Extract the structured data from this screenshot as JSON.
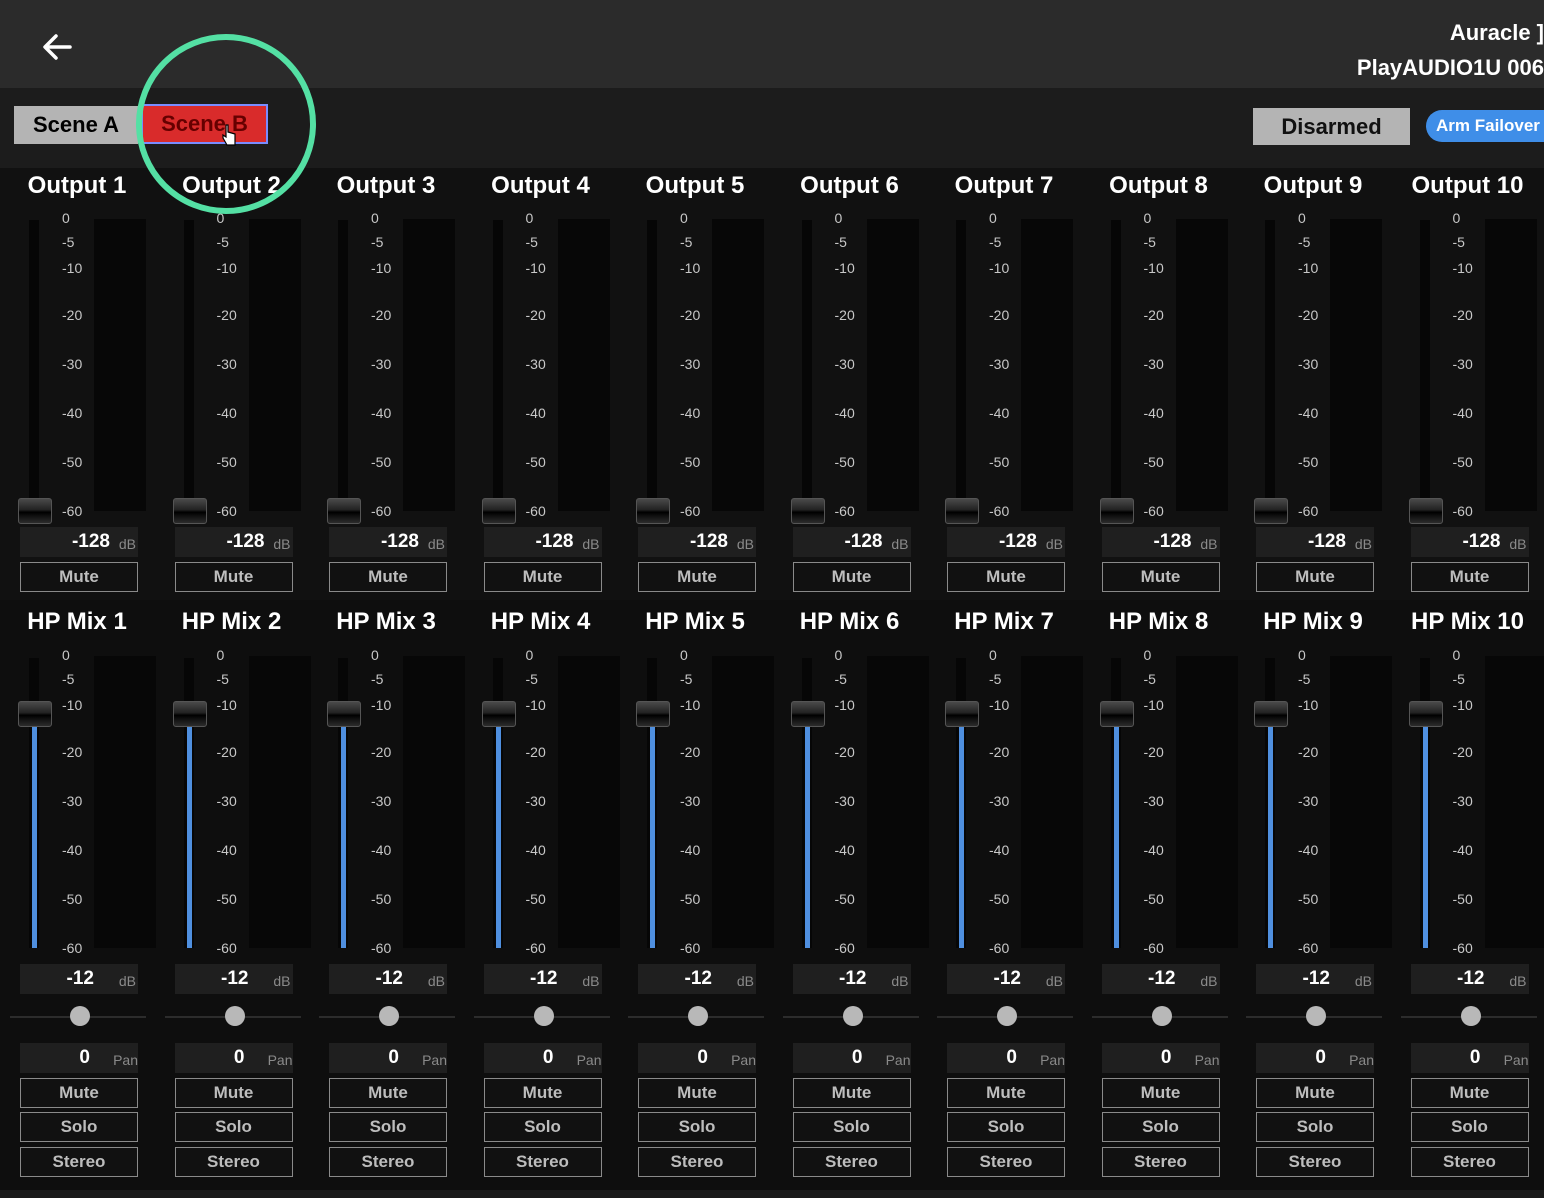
{
  "header": {
    "device_name": "Auracle ]",
    "device_id": "PlayAUDIO1U 006"
  },
  "scenes": {
    "scene_a": "Scene A",
    "scene_b": "Scene B"
  },
  "failover": {
    "status": "Disarmed",
    "arm_label": "Arm Failover"
  },
  "colors": {
    "scene_active": "#d92b2b",
    "highlight_ring": "#54e0a4",
    "fader_fill": "#4f8fdf",
    "arm_button": "#3f8ee8"
  },
  "scale_labels": [
    "0",
    "-5",
    "-10",
    "-20",
    "-30",
    "-40",
    "-50",
    "-60"
  ],
  "outputs": [
    {
      "title": "Output 1",
      "level": "-128",
      "unit": "dB",
      "mute": "Mute"
    },
    {
      "title": "Output 2",
      "level": "-128",
      "unit": "dB",
      "mute": "Mute"
    },
    {
      "title": "Output 3",
      "level": "-128",
      "unit": "dB",
      "mute": "Mute"
    },
    {
      "title": "Output 4",
      "level": "-128",
      "unit": "dB",
      "mute": "Mute"
    },
    {
      "title": "Output 5",
      "level": "-128",
      "unit": "dB",
      "mute": "Mute"
    },
    {
      "title": "Output 6",
      "level": "-128",
      "unit": "dB",
      "mute": "Mute"
    },
    {
      "title": "Output 7",
      "level": "-128",
      "unit": "dB",
      "mute": "Mute"
    },
    {
      "title": "Output 8",
      "level": "-128",
      "unit": "dB",
      "mute": "Mute"
    },
    {
      "title": "Output 9",
      "level": "-128",
      "unit": "dB",
      "mute": "Mute"
    },
    {
      "title": "Output 10",
      "level": "-128",
      "unit": "dB",
      "mute": "Mute"
    }
  ],
  "hp_mixes": [
    {
      "title": "HP Mix 1",
      "level": "-12",
      "unit": "dB",
      "pan": "0",
      "pan_label": "Pan",
      "mute": "Mute",
      "solo": "Solo",
      "stereo": "Stereo"
    },
    {
      "title": "HP Mix 2",
      "level": "-12",
      "unit": "dB",
      "pan": "0",
      "pan_label": "Pan",
      "mute": "Mute",
      "solo": "Solo",
      "stereo": "Stereo"
    },
    {
      "title": "HP Mix 3",
      "level": "-12",
      "unit": "dB",
      "pan": "0",
      "pan_label": "Pan",
      "mute": "Mute",
      "solo": "Solo",
      "stereo": "Stereo"
    },
    {
      "title": "HP Mix 4",
      "level": "-12",
      "unit": "dB",
      "pan": "0",
      "pan_label": "Pan",
      "mute": "Mute",
      "solo": "Solo",
      "stereo": "Stereo"
    },
    {
      "title": "HP Mix 5",
      "level": "-12",
      "unit": "dB",
      "pan": "0",
      "pan_label": "Pan",
      "mute": "Mute",
      "solo": "Solo",
      "stereo": "Stereo"
    },
    {
      "title": "HP Mix 6",
      "level": "-12",
      "unit": "dB",
      "pan": "0",
      "pan_label": "Pan",
      "mute": "Mute",
      "solo": "Solo",
      "stereo": "Stereo"
    },
    {
      "title": "HP Mix 7",
      "level": "-12",
      "unit": "dB",
      "pan": "0",
      "pan_label": "Pan",
      "mute": "Mute",
      "solo": "Solo",
      "stereo": "Stereo"
    },
    {
      "title": "HP Mix 8",
      "level": "-12",
      "unit": "dB",
      "pan": "0",
      "pan_label": "Pan",
      "mute": "Mute",
      "solo": "Solo",
      "stereo": "Stereo"
    },
    {
      "title": "HP Mix 9",
      "level": "-12",
      "unit": "dB",
      "pan": "0",
      "pan_label": "Pan",
      "mute": "Mute",
      "solo": "Solo",
      "stereo": "Stereo"
    },
    {
      "title": "HP Mix 10",
      "level": "-12",
      "unit": "dB",
      "pan": "0",
      "pan_label": "Pan",
      "mute": "Mute",
      "solo": "Solo",
      "stereo": "Stereo"
    }
  ]
}
